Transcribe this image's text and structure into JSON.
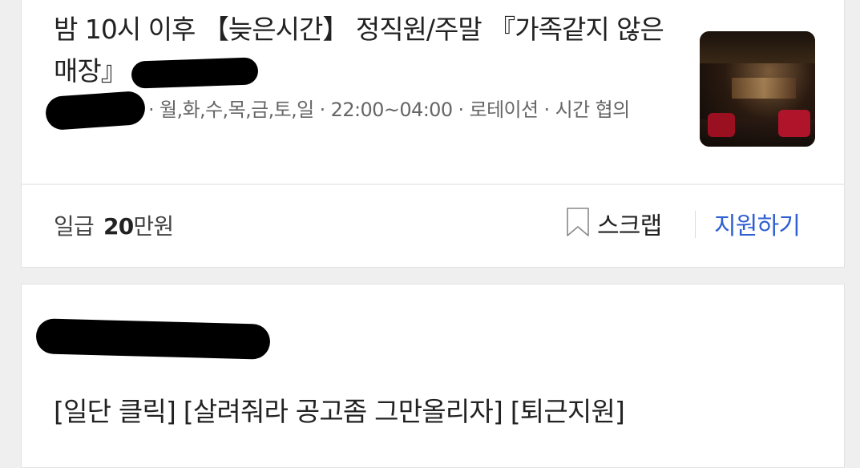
{
  "listing1": {
    "title": "밤 10시 이후 【늦은시간】 정직원/주말 『가족같지 않은 매장』",
    "meta": "· 월,화,수,목,금,토,일 · 22:00~04:00 · 로테이션 · 시간 협의",
    "pay_label": "일급",
    "pay_value": "20",
    "pay_unit": "만원",
    "scrap_label": "스크랩",
    "apply_label": "지원하기"
  },
  "listing2": {
    "title": "[일단 클릭] [살려줘라 공고좀 그만올리자] [퇴근지원]"
  },
  "colors": {
    "accent": "#2f5fd0",
    "background": "#efefef",
    "card": "#ffffff"
  },
  "icons": {
    "scrap": "bookmark-outline-icon"
  }
}
